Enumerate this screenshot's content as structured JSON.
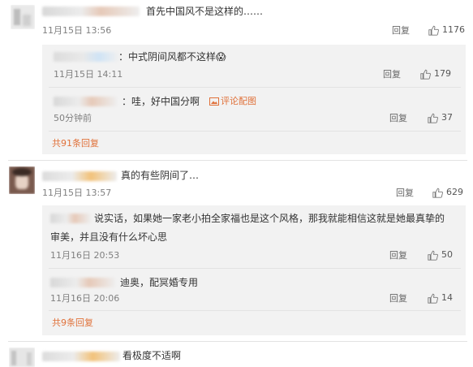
{
  "comments": [
    {
      "text": "首先中国风不是这样的……",
      "time": "11月15日 13:56",
      "reply_label": "回复",
      "likes": "1176",
      "sub": [
        {
          "text": "：中式阴间风都不这样",
          "emoji": "😱",
          "time": "11月15日 14:11",
          "reply_label": "回复",
          "likes": "179"
        },
        {
          "text": "：哇，好中国分啊",
          "report_label": "评论配图",
          "time": "50分钟前",
          "reply_label": "回复",
          "likes": "37"
        }
      ],
      "more_label": "共91条回复"
    },
    {
      "text": "真的有些阴间了…",
      "time": "11月15日 13:57",
      "reply_label": "回复",
      "likes": "629",
      "sub": [
        {
          "text_line1": "说实话，如果她一家老小拍全家福也是这个风格，那我就能相信这就是她最真挚的",
          "text_line2": "审美，并且没有什么坏心思",
          "time": "11月16日 20:53",
          "reply_label": "回复",
          "likes": "50"
        },
        {
          "text": "迪奥，配冥婚专用",
          "time": "11月16日 20:06",
          "reply_label": "回复",
          "likes": "14"
        }
      ],
      "more_label": "共9条回复"
    },
    {
      "text": "看极度不适啊"
    }
  ],
  "icons": {
    "like": "thumbs-up-icon",
    "picture": "picture-icon"
  },
  "colors": {
    "link": "#e0713a",
    "muted": "#808080",
    "sub_bg": "#f2f2f2"
  }
}
